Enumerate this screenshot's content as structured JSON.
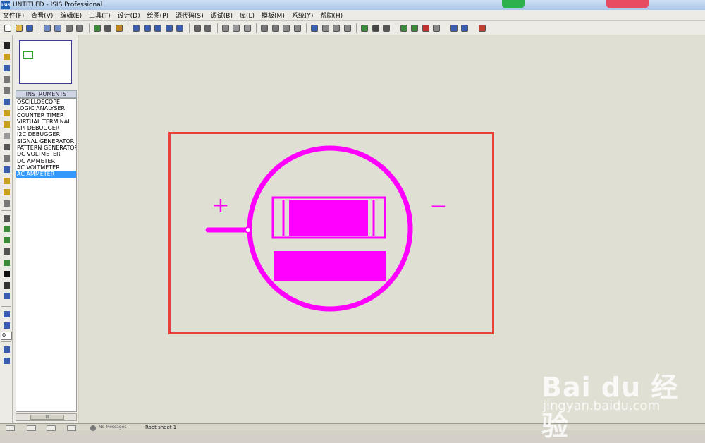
{
  "window": {
    "app_icon_label": "ISIS",
    "title": "UNTITLED - ISIS Professional"
  },
  "menu": {
    "items": [
      "文件(F)",
      "查看(V)",
      "编辑(E)",
      "工具(T)",
      "设计(D)",
      "绘图(P)",
      "源代码(S)",
      "调试(B)",
      "库(L)",
      "模板(M)",
      "系统(Y)",
      "帮助(H)"
    ]
  },
  "side_panel": {
    "selector_header": "INSTRUMENTS",
    "devices": [
      "OSCILLOSCOPE",
      "LOGIC ANALYSER",
      "COUNTER TIMER",
      "VIRTUAL TERMINAL",
      "SPI DEBUGGER",
      "I2C DEBUGGER",
      "SIGNAL GENERATOR",
      "PATTERN GENERATOR",
      "DC VOLTMETER",
      "DC AMMETER",
      "AC VOLTMETER",
      "AC AMMETER"
    ],
    "selected_device": "AC AMMETER",
    "scroll_grip": "III",
    "rotation_value": "0"
  },
  "canvas": {
    "plus_sign": "+",
    "minus_sign": "−",
    "symbol_color": "#ff00ff",
    "border_color": "#e8423a",
    "background_color": "#e0dfd3"
  },
  "status": {
    "message": "No Messages",
    "sheet": "Root sheet 1"
  },
  "watermark": {
    "logo": "Bai du 经验",
    "url": "jingyan.baidu.com"
  }
}
